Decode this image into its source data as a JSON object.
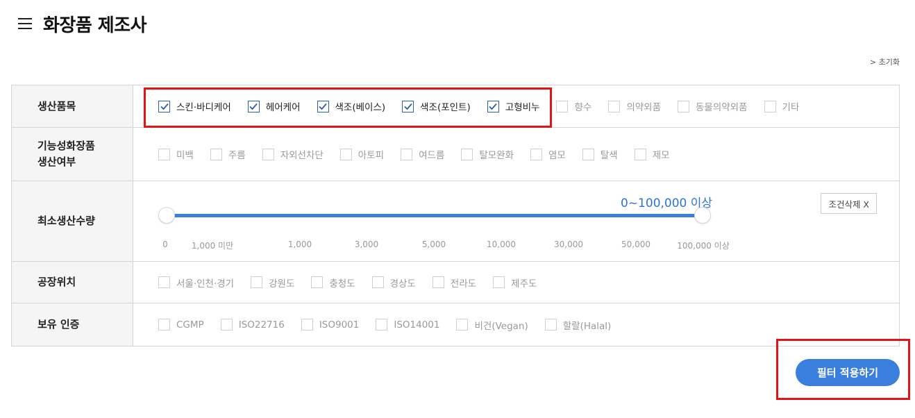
{
  "header": {
    "title": "화장품 제조사",
    "menu_icon": "hamburger-icon"
  },
  "reset_link": "> 초기화",
  "rows": {
    "product": {
      "label": "생산품목",
      "options": [
        {
          "label": "스킨·바디케어",
          "checked": true
        },
        {
          "label": "헤어케어",
          "checked": true
        },
        {
          "label": "색조(베이스)",
          "checked": true
        },
        {
          "label": "색조(포인트)",
          "checked": true
        },
        {
          "label": "고형비누",
          "checked": true
        },
        {
          "label": "향수",
          "checked": false
        },
        {
          "label": "의약외품",
          "checked": false
        },
        {
          "label": "동물의약외품",
          "checked": false
        },
        {
          "label": "기타",
          "checked": false
        }
      ]
    },
    "functional": {
      "label_line1": "기능성화장품",
      "label_line2": "생산여부",
      "options": [
        {
          "label": "미백",
          "checked": false
        },
        {
          "label": "주름",
          "checked": false
        },
        {
          "label": "자외선차단",
          "checked": false
        },
        {
          "label": "아토피",
          "checked": false
        },
        {
          "label": "여드름",
          "checked": false
        },
        {
          "label": "탈모완화",
          "checked": false
        },
        {
          "label": "염모",
          "checked": false
        },
        {
          "label": "탈색",
          "checked": false
        },
        {
          "label": "제모",
          "checked": false
        }
      ]
    },
    "min_qty": {
      "label": "최소생산수량",
      "value_text": "0~100,000 이상",
      "range": {
        "min_index": 0,
        "max_index": 8
      },
      "ticks": [
        "0",
        "1,000 미만",
        "1,000",
        "3,000",
        "5,000",
        "10,000",
        "30,000",
        "50,000",
        "100,000 이상"
      ],
      "clear_label": "조건삭제 X"
    },
    "location": {
      "label": "공장위치",
      "options": [
        {
          "label": "서울·인천·경기",
          "checked": false
        },
        {
          "label": "강원도",
          "checked": false
        },
        {
          "label": "충청도",
          "checked": false
        },
        {
          "label": "경상도",
          "checked": false
        },
        {
          "label": "전라도",
          "checked": false
        },
        {
          "label": "제주도",
          "checked": false
        }
      ]
    },
    "certification": {
      "label": "보유 인증",
      "options": [
        {
          "label": "CGMP",
          "checked": false
        },
        {
          "label": "ISO22716",
          "checked": false
        },
        {
          "label": "ISO9001",
          "checked": false
        },
        {
          "label": "ISO14001",
          "checked": false
        },
        {
          "label": "비건(Vegan)",
          "checked": false
        },
        {
          "label": "할랄(Halal)",
          "checked": false
        }
      ]
    }
  },
  "apply_button": "필터 적용하기",
  "colors": {
    "accent": "#3a7fde",
    "highlight": "#e51414",
    "check": "#2b5fa8"
  }
}
